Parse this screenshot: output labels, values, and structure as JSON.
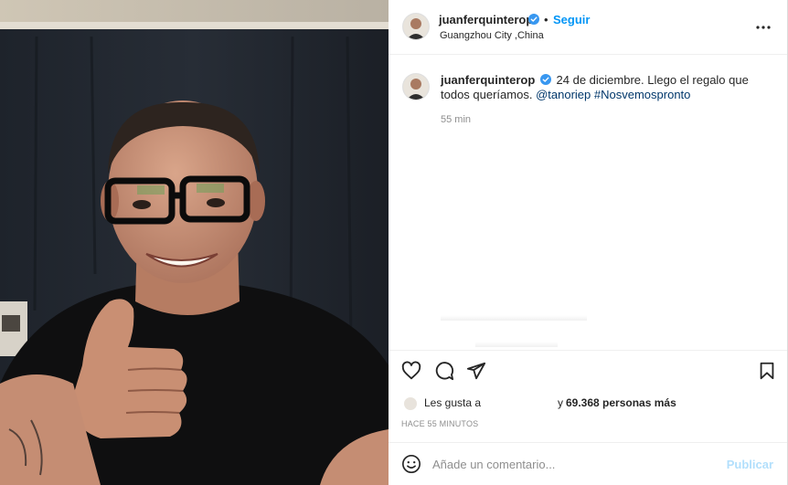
{
  "post": {
    "username": "juanferquinterop",
    "follow_label": "Seguir",
    "separator": "•",
    "location": "Guangzhou City ,China",
    "more_icon": "more-horizontal-icon",
    "verified_color": "#3897f0"
  },
  "caption": {
    "username": "juanferquinterop",
    "text": "24 de diciembre. Llego el regalo que todos queríamos.",
    "mention": "@tanoriep",
    "hashtag": "#Nosvemospronto",
    "time": "55 min"
  },
  "actions": {
    "like_icon": "heart-icon",
    "comment_icon": "comment-icon",
    "share_icon": "send-icon",
    "save_icon": "bookmark-icon"
  },
  "likes": {
    "prefix": "Les gusta a",
    "suffix": "y",
    "count": "69.368 personas más"
  },
  "timestamp": "HACE 55 MINUTOS",
  "comment": {
    "placeholder": "Añade un comentario...",
    "publish_label": "Publicar",
    "emoji_icon": "smiley-icon"
  },
  "colors": {
    "accent": "#0095f6",
    "link": "#00376b",
    "muted": "#8e8e8e",
    "publish_disabled": "#b2dffc"
  }
}
